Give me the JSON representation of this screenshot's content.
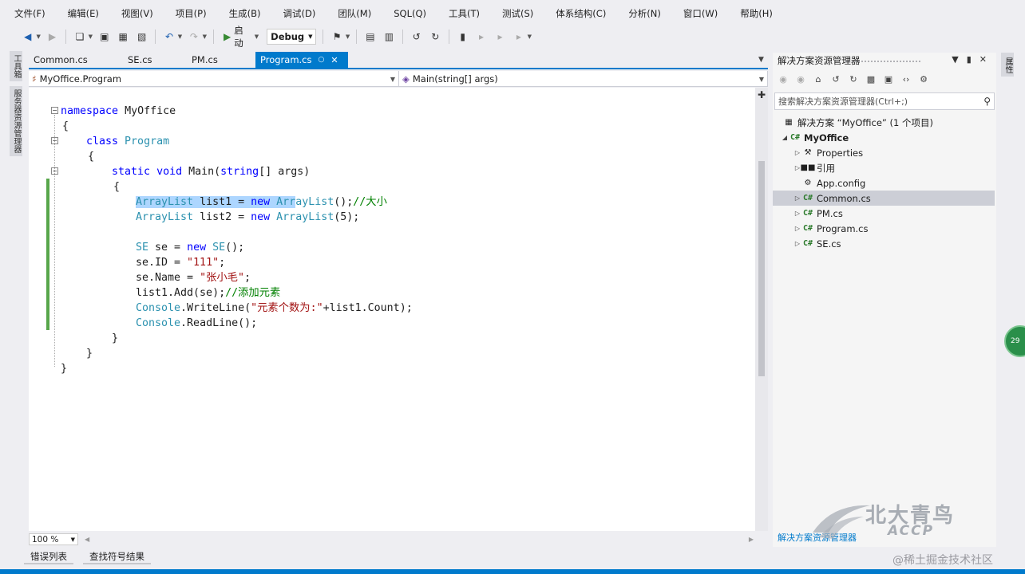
{
  "menu": [
    "文件(F)",
    "编辑(E)",
    "视图(V)",
    "项目(P)",
    "生成(B)",
    "调试(D)",
    "团队(M)",
    "SQL(Q)",
    "工具(T)",
    "测试(S)",
    "体系结构(C)",
    "分析(N)",
    "窗口(W)",
    "帮助(H)"
  ],
  "toolbar": {
    "start_label": "启动",
    "config_value": "Debug"
  },
  "left_strip": [
    "工具箱",
    "服务器资源管理器"
  ],
  "tabs": [
    {
      "label": "Common.cs",
      "active": false
    },
    {
      "label": "SE.cs",
      "active": false
    },
    {
      "label": "PM.cs",
      "active": false
    },
    {
      "label": "Program.cs",
      "active": true
    }
  ],
  "navbar": {
    "type_value": "MyOffice.Program",
    "member_value": "Main(string[] args)"
  },
  "code": {
    "l1_kw": "namespace",
    "l1_rest": " MyOffice",
    "l2": "{",
    "l3_kw": "class",
    "l3_ty": "Program",
    "l4": "{",
    "l5_kw1": "static",
    "l5_kw2": "void",
    "l5_rest1": " Main(",
    "l5_kw3": "string",
    "l5_rest2": "[] args)",
    "l6": "{",
    "l7_ty1": "ArrayList",
    "l7_mid": " list1 = ",
    "l7_kw": "new",
    "l7_ty2a": "Arr",
    "l7_ty2b": "ayList",
    "l7_rest": "();",
    "l7_cm": "//大小",
    "l8_ty1": "ArrayList",
    "l8_mid": " list2 = ",
    "l8_kw": "new",
    "l8_ty2": "ArrayList",
    "l8_rest": "(5);",
    "l10_ty1": "SE",
    "l10_mid": " se = ",
    "l10_kw": "new",
    "l10_ty2": "SE",
    "l10_rest": "();",
    "l11_pre": "se.ID = ",
    "l11_str": "\"111\"",
    "l11_post": ";",
    "l12_pre": "se.Name = ",
    "l12_str": "\"张小毛\"",
    "l12_post": ";",
    "l13_pre": "list1.Add(se);",
    "l13_cm": "//添加元素",
    "l14_ty": "Console",
    "l14_pre": ".WriteLine(",
    "l14_str": "\"元素个数为:\"",
    "l14_post": "+list1.Count);",
    "l15_ty": "Console",
    "l15_rest": ".ReadLine();",
    "l16": "}",
    "l17": "}",
    "l18": "}"
  },
  "zoom": "100 %",
  "bottom_tabs": [
    "错误列表",
    "查找符号结果"
  ],
  "solution_explorer": {
    "title": "解决方案资源管理器",
    "search_placeholder": "搜索解决方案资源管理器(Ctrl+;)",
    "tree": [
      {
        "label": "解决方案 “MyOffice” (1 个项目)",
        "bold": false
      },
      {
        "label": "MyOffice",
        "bold": true
      },
      {
        "label": "Properties",
        "bold": false
      },
      {
        "label": "引用",
        "bold": false
      },
      {
        "label": "App.config",
        "bold": false
      },
      {
        "label": "Common.cs",
        "bold": false,
        "selected": true
      },
      {
        "label": "PM.cs",
        "bold": false
      },
      {
        "label": "Program.cs",
        "bold": false
      },
      {
        "label": "SE.cs",
        "bold": false
      }
    ],
    "bottom_tab": "解决方案资源管理器"
  },
  "right_strip": "属性",
  "badge": "29",
  "watermark": {
    "cn": "北大青鸟",
    "en": "ACCP"
  },
  "site_mark": "@稀土掘金技术社区"
}
